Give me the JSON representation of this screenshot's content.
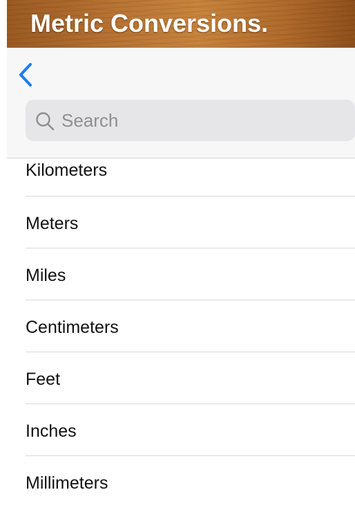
{
  "banner": {
    "title": "Metric Conversions."
  },
  "nav": {
    "back_icon": "chevron-left-icon",
    "accent_color": "#1a7cf5"
  },
  "search": {
    "placeholder": "Search",
    "value": "",
    "icon": "magnifier-icon"
  },
  "units": [
    {
      "label": "Kilometers"
    },
    {
      "label": "Meters"
    },
    {
      "label": "Miles"
    },
    {
      "label": "Centimeters"
    },
    {
      "label": "Feet"
    },
    {
      "label": "Inches"
    },
    {
      "label": "Millimeters"
    }
  ]
}
